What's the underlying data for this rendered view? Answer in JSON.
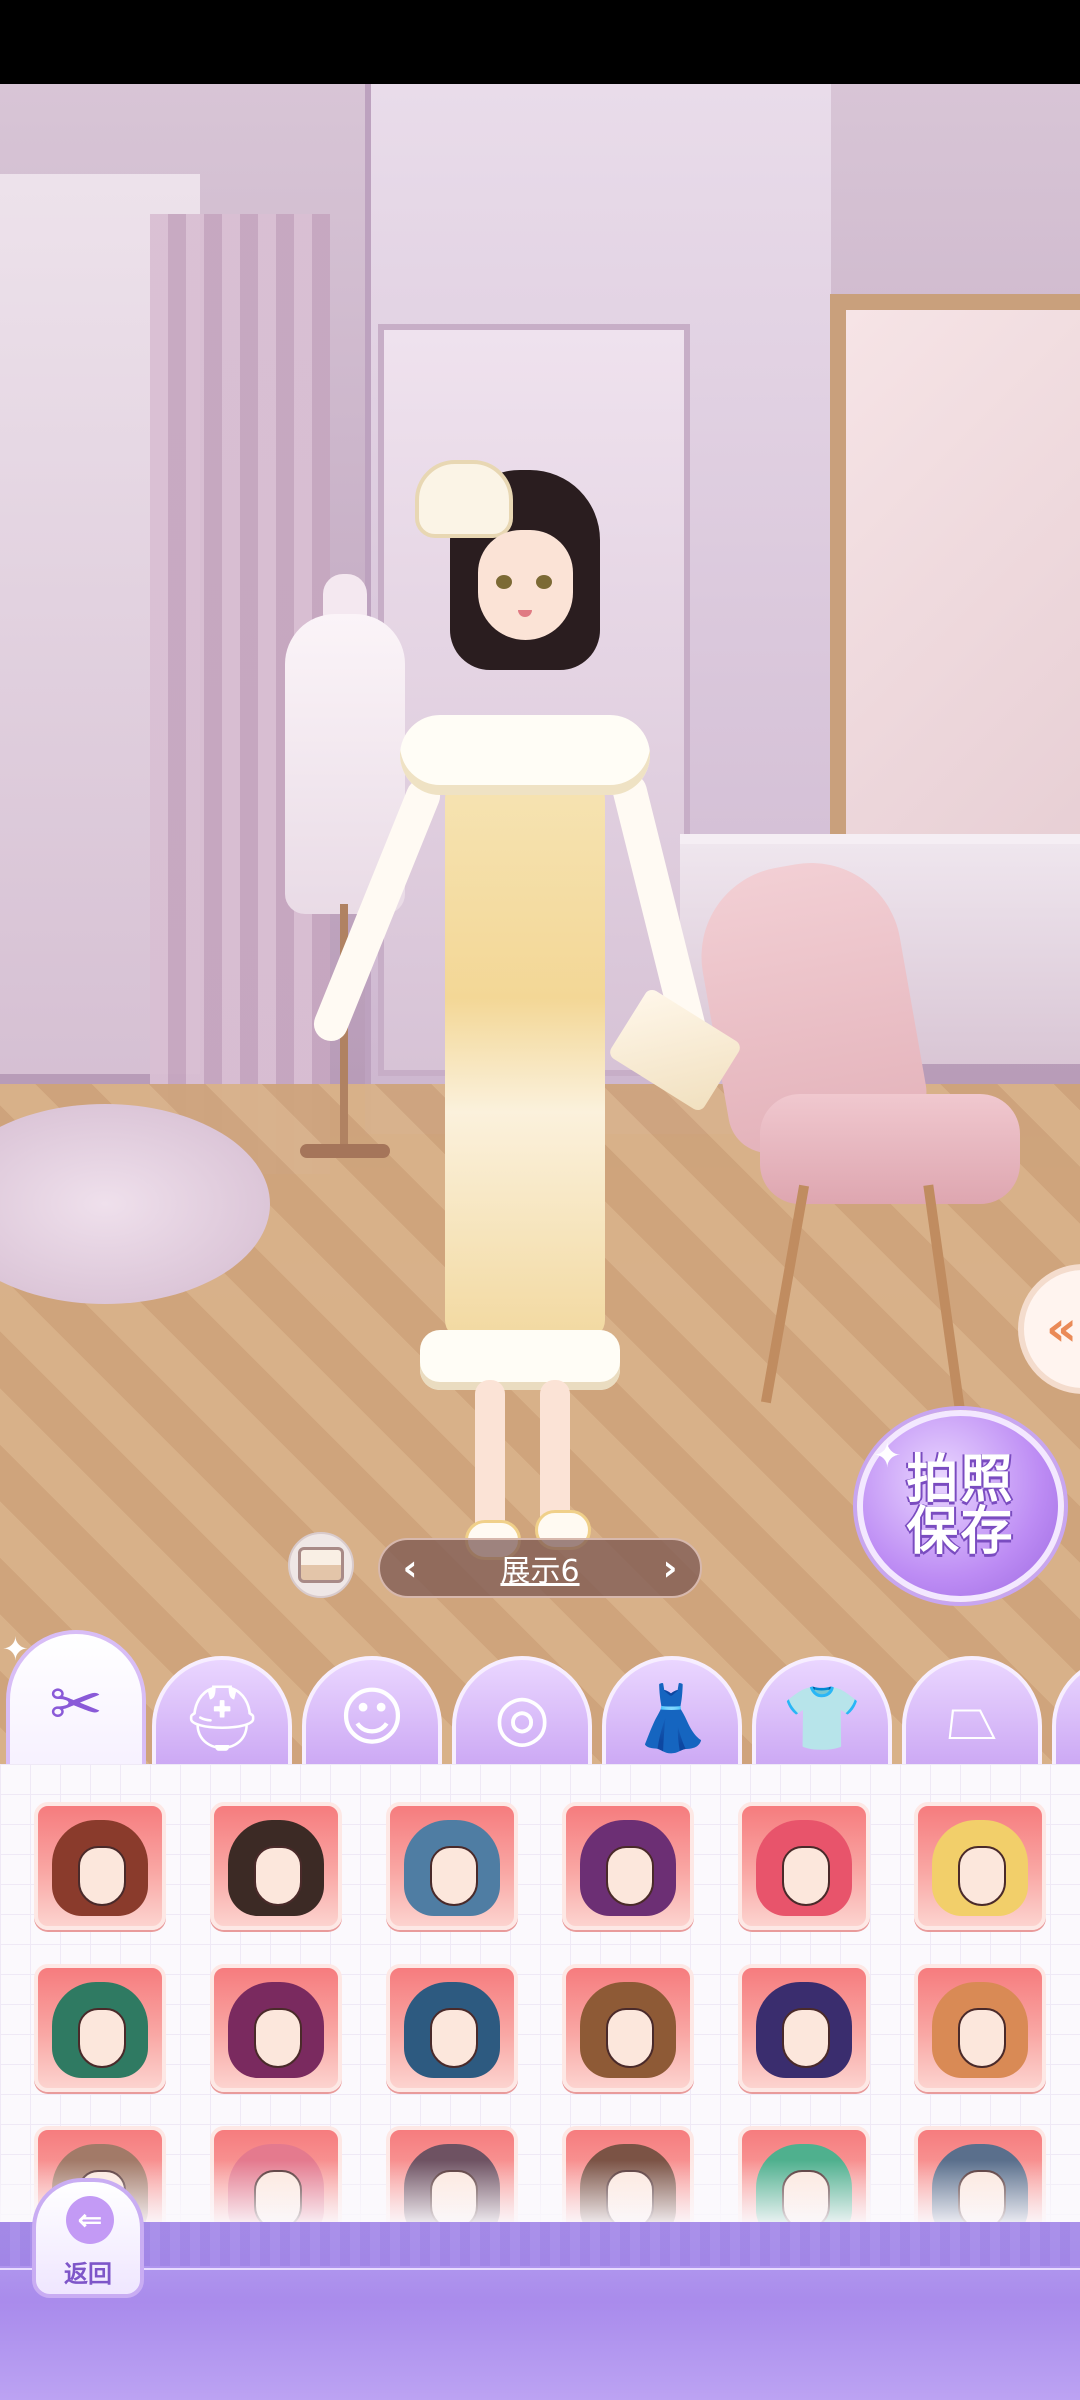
{
  "display_selector": {
    "label": "展示6",
    "prev_icon": "chevron-left-icon",
    "next_icon": "chevron-right-icon"
  },
  "photo_save": {
    "line1": "拍照",
    "line2": "保存"
  },
  "expand_tab": {
    "icon": "double-chevron-left-icon",
    "glyph": "«"
  },
  "gallery_button": {
    "icon": "gallery-icon"
  },
  "category_tabs": [
    {
      "id": "hairstyle",
      "icon": "scissors-icon",
      "glyph": "✂",
      "active": true
    },
    {
      "id": "hat",
      "icon": "hat-icon",
      "glyph": "⛑",
      "active": false
    },
    {
      "id": "face",
      "icon": "face-icon",
      "glyph": "☺",
      "active": false
    },
    {
      "id": "earrings",
      "icon": "earrings-icon",
      "glyph": "◎",
      "active": false
    },
    {
      "id": "dress",
      "icon": "dress-icon",
      "glyph": "👗",
      "active": false
    },
    {
      "id": "top",
      "icon": "shirt-icon",
      "glyph": "👕",
      "active": false
    },
    {
      "id": "skirt",
      "icon": "skirt-icon",
      "glyph": "⏢",
      "active": false
    },
    {
      "id": "more",
      "icon": "more-tab-icon",
      "glyph": "",
      "active": false
    }
  ],
  "hair_items": [
    {
      "color": "#8a3b2c"
    },
    {
      "color": "#3c2a25"
    },
    {
      "color": "#4f7da3"
    },
    {
      "color": "#6c2f74"
    },
    {
      "color": "#e8546b"
    },
    {
      "color": "#f2cf6a"
    },
    {
      "color": "#2f7a62"
    },
    {
      "color": "#7a2a5f"
    },
    {
      "color": "#2d5a80"
    },
    {
      "color": "#8e5a36"
    },
    {
      "color": "#3a2d6e"
    },
    {
      "color": "#d98a55"
    },
    {
      "color": "#a27a68"
    },
    {
      "color": "#e47a8e"
    },
    {
      "color": "#6e5262"
    },
    {
      "color": "#7b5345"
    },
    {
      "color": "#4fb08e"
    },
    {
      "color": "#5a6f8c"
    }
  ],
  "back_button": {
    "label": "返回",
    "icon": "back-arrow-icon"
  }
}
